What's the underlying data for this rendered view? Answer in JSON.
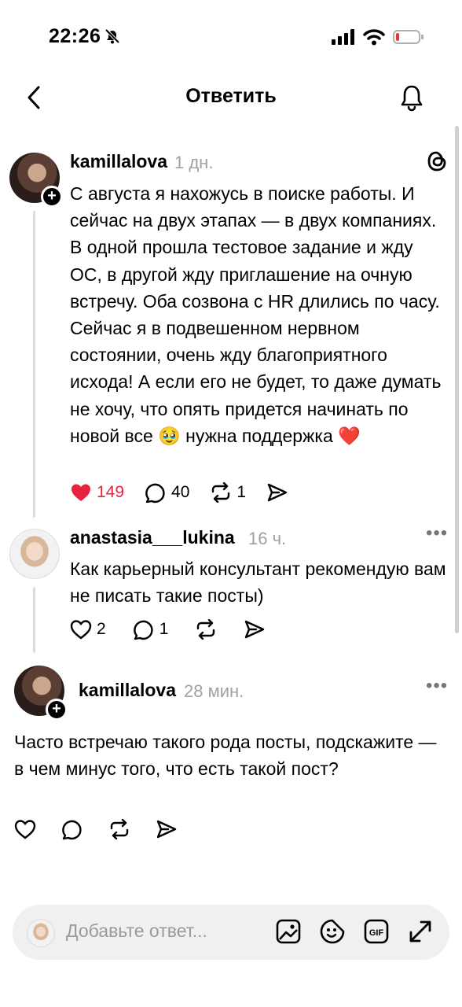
{
  "status": {
    "time": "22:26"
  },
  "nav": {
    "title": "Ответить"
  },
  "post": {
    "username": "kamillalova",
    "time": "1 дн.",
    "text": "С августа я нахожусь в поиске работы. И сейчас на двух этапах — в двух компаниях. В одной прошла тестовое задание и жду ОС, в другой жду приглашение на очную встречу. Оба созвона с HR длились по часу. Сейчас я в подвешенном нервном состоянии, очень жду благоприятного исхода! А если его не будет, то даже думать не хочу, что опять придется начинать по новой все 🥹 нужна поддержка ❤️",
    "likes": "149",
    "comments": "40",
    "reposts": "1",
    "like_color": "#e8233f"
  },
  "reply1": {
    "username": "anastasia___lukina",
    "time": "16 ч.",
    "text": "Как карьерный консультант рекомендую вам не писать такие посты)",
    "likes": "2",
    "comments": "1"
  },
  "reply2": {
    "username": "kamillalova",
    "time": "28 мин.",
    "text": "Часто встречаю такого рода посты, подскажите — в чем минус того, что есть такой пост?"
  },
  "composer": {
    "placeholder": "Добавьте ответ..."
  }
}
